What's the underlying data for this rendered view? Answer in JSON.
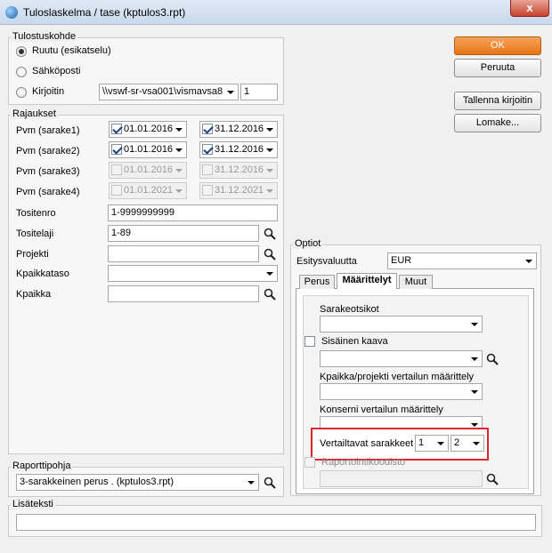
{
  "window": {
    "title": "Tuloslaskelma / tase (kptulos3.rpt)",
    "close_glyph": "x"
  },
  "output": {
    "legend": "Tulostuskohde",
    "options": [
      "Ruutu (esikatselu)",
      "Sähköposti",
      "Kirjoitin"
    ],
    "selected": "Ruutu (esikatselu)",
    "printer_path": "\\\\vswf-sr-vsa001\\vismavsa8",
    "copies": "1"
  },
  "limits": {
    "legend": "Rajaukset",
    "dates": [
      {
        "label": "Pvm (sarake1)",
        "from": "01.01.2016",
        "to": "31.12.2016",
        "checked": true
      },
      {
        "label": "Pvm (sarake2)",
        "from": "01.01.2016",
        "to": "31.12.2016",
        "checked": true
      },
      {
        "label": "Pvm (sarake3)",
        "from": "01.01.2016",
        "to": "31.12.2016",
        "checked": false
      },
      {
        "label": "Pvm (sarake4)",
        "from": "01.01.2021",
        "to": "31.12.2021",
        "checked": false
      }
    ],
    "tositenro_label": "Tositenro",
    "tositenro_value": "1-9999999999",
    "tositelaji_label": "Tositelaji",
    "tositelaji_value": "1-89",
    "projekti_label": "Projekti",
    "projekti_value": "",
    "kpaikkataso_label": "Kpaikkataso",
    "kpaikkataso_value": "",
    "kpaikka_label": "Kpaikka",
    "kpaikka_value": ""
  },
  "buttons": {
    "ok": "OK",
    "cancel": "Peruuta",
    "save_printer": "Tallenna kirjoitin",
    "form": "Lomake..."
  },
  "options_panel": {
    "legend": "Optiot",
    "currency_label": "Esitysvaluutta",
    "currency_value": "EUR",
    "tabs": [
      "Perus",
      "Määrittelyt",
      "Muut"
    ],
    "active_tab": "Määrittelyt",
    "column_headers_label": "Sarakeotsikot",
    "column_headers_value": "",
    "internal_formula_label": "Sisäinen kaava",
    "internal_formula_value": "",
    "cc_project_label": "Kpaikka/projekti vertailun määrittely",
    "cc_project_value": "",
    "group_label": "Konserni vertailun määrittely",
    "group_value": "",
    "compare_columns_label": "Vertailtavat sarakkeet",
    "compare_col_a": "1",
    "compare_col_b": "2",
    "reporting_codes_label": "Raportointikoodisto",
    "reporting_codes_value": ""
  },
  "report_template": {
    "legend": "Raporttipohja",
    "value": "3-sarakkeinen perus . (kptulos3.rpt)"
  },
  "extra_text": {
    "legend": "Lisäteksti",
    "value": ""
  },
  "colors": {
    "accent_ok": "#e87415",
    "highlight": "#e0232f"
  },
  "icons": {
    "lookup": "magnifier-icon",
    "dropdown": "chevron-down-icon",
    "app": "app-logo-icon"
  }
}
